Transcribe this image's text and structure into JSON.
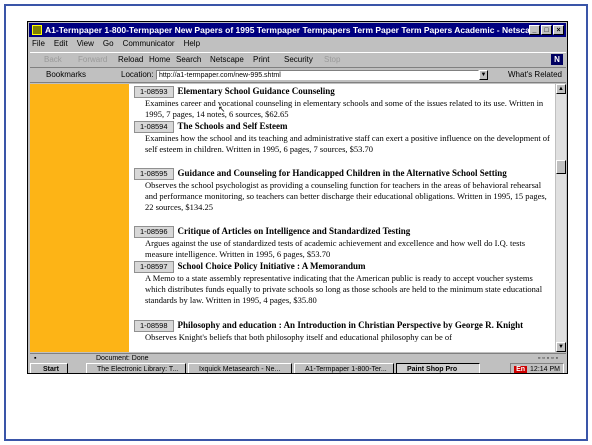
{
  "window": {
    "title": "A1-Termpaper 1-800-Termpaper New Papers of 1995 Termpaper Termpapers Term Paper Term Papers Academic - Netscape",
    "buttons": [
      "_",
      "□",
      "×"
    ]
  },
  "menu": [
    "File",
    "Edit",
    "View",
    "Go",
    "Communicator",
    "Help"
  ],
  "toolbar": {
    "back": "Back",
    "forward": "Forward",
    "reload": "Reload",
    "home": "Home",
    "search": "Search",
    "netscape": "Netscape",
    "print": "Print",
    "security": "Security",
    "stop": "Stop"
  },
  "location": {
    "bookmarks": "Bookmarks",
    "label": "Location:",
    "url": "http://a1-termpaper.com/new-995.shtml",
    "related": "What's Related"
  },
  "entries": [
    {
      "id": "1-08593",
      "title": "Elementary School Guidance Counseling",
      "desc": "Examines career and vocational counseling in elementary schools and some of the issues related to its use.   Written in 1995,  7 pages,  14 notes,  6 sources,  $62.65"
    },
    {
      "id": "1-08594",
      "title": "The Schools and Self Esteem",
      "desc": "Examines how the school and its teaching and administrative staff can exert a positive influence on the development of self esteem in children.   Written in 1995,  6 pages,  7 sources,  $53.70"
    },
    {
      "id": "1-08595",
      "title": "Guidance and Counseling for Handicapped Children in the Alternative School Setting",
      "desc": "Observes the school psychologist as providing a counseling function for teachers in the areas of behavioral rehearsal and performance monitoring, so teachers can better discharge their educational obligations.   Written in 1995,  15 pages,  22 sources,  $134.25"
    },
    {
      "id": "1-08596",
      "title": "Critique of Articles on Intelligence and Standardized Testing",
      "desc": "Argues against the use of standardized tests of academic achievement and excellence and how well do I.Q. tests measure intelligence.   Written in 1995,  6 pages,  $53.70"
    },
    {
      "id": "1-08597",
      "title": "School Choice Policy Initiative : A Memorandum",
      "desc": "A Memo to a state assembly representative indicating that the American public is ready to accept voucher systems which distributes funds equally to private schools so long as those schools are held to the minimum state educational standards by law.   Written in 1995,  4 pages,  $35.80"
    },
    {
      "id": "1-08598",
      "title": "Philosophy and education : An Introduction in Christian Perspective by George R. Knight",
      "desc": "Observes Knight's beliefs that both philosophy itself and educational philosophy can be of"
    }
  ],
  "status": {
    "text": "Document: Done"
  },
  "taskbar": {
    "start": "Start",
    "items": [
      "The Electronic Library: T...",
      "Ixquick Metasearch - Ne...",
      "A1-Termpaper 1-800-Ter...",
      "Paint Shop Pro"
    ],
    "active_index": 3,
    "clock": "12:14 PM",
    "lang": "En"
  }
}
